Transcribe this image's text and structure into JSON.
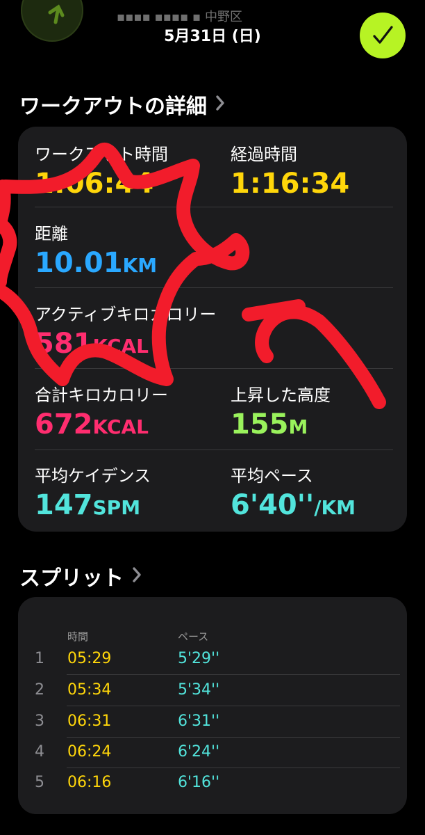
{
  "header": {
    "date": "5月31日 (日)",
    "subtitle": "▪▪▪▪ ▪▪▪▪  ▪ 中野区"
  },
  "colors": {
    "yellow": "#ffd60a",
    "blue": "#2aa8ff",
    "pink": "#ff2d6f",
    "green": "#9af25c",
    "cyan": "#52e4dc",
    "done_green": "#b7f324",
    "annotation_red": "#f21c2b"
  },
  "workout_details": {
    "title": "ワークアウトの詳細",
    "metrics": {
      "workout_time": {
        "label": "ワークアウト時間",
        "value": "1:06:44"
      },
      "elapsed_time": {
        "label": "経過時間",
        "value": "1:16:34"
      },
      "distance": {
        "label": "距離",
        "value": "10.01",
        "unit": "KM"
      },
      "active_kcal": {
        "label": "アクティブキロカロリー",
        "value": "581",
        "unit": "KCAL"
      },
      "total_kcal": {
        "label": "合計キロカロリー",
        "value": "672",
        "unit": "KCAL"
      },
      "elevation": {
        "label": "上昇した高度",
        "value": "155",
        "unit": "M"
      },
      "cadence": {
        "label": "平均ケイデンス",
        "value": "147",
        "unit": "SPM"
      },
      "pace": {
        "label": "平均ペース",
        "value": "6'40''",
        "unit": "/KM"
      }
    }
  },
  "splits": {
    "title": "スプリット",
    "col_time": "時間",
    "col_pace": "ペース",
    "rows": [
      {
        "index": "1",
        "time": "05:29",
        "pace": "5'29''"
      },
      {
        "index": "2",
        "time": "05:34",
        "pace": "5'34''"
      },
      {
        "index": "3",
        "time": "06:31",
        "pace": "6'31''"
      },
      {
        "index": "4",
        "time": "06:24",
        "pace": "6'24''"
      },
      {
        "index": "5",
        "time": "06:16",
        "pace": "6'16''"
      }
    ]
  }
}
